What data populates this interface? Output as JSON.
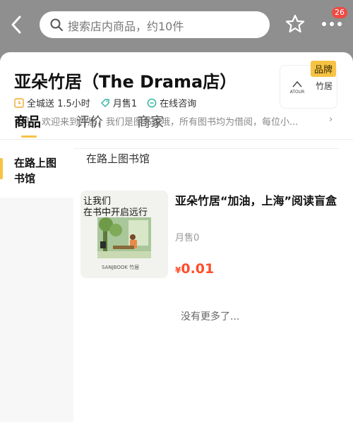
{
  "search": {
    "placeholder": "搜索店内商品，约10件"
  },
  "topbar": {
    "back_icon": "chevron-left-icon",
    "favorite_icon": "star-icon",
    "more_icon": "more-dots-icon",
    "notification_count": "26"
  },
  "store": {
    "name": "亚朵竹居（The Drama店）",
    "delivery": "全城送 1.5小时",
    "monthly_sales": "月售1",
    "consult": "在线咨询",
    "notice": "公告：欢迎来到竹居，我们是图书馆哦，所有图书均为借阅，每位小...",
    "brand_tag": "品牌",
    "logo_text": "竹居",
    "logo_mark": "ATOUR"
  },
  "tabs": [
    {
      "label": "商品",
      "active": true
    },
    {
      "label": "评价",
      "active": false
    },
    {
      "label": "商家",
      "active": false
    }
  ],
  "sidebar": {
    "categories": [
      {
        "label": "在路上图书馆",
        "selected": true
      }
    ]
  },
  "section": {
    "title": "在路上图书馆"
  },
  "product": {
    "thumb_caption_1": "让我们",
    "thumb_caption_2": "在书中开启远行",
    "thumb_brandline": "SANJBOOK 竹居",
    "title": "亚朵竹居“加油，上海”阅读盲盒",
    "sold": "月售0",
    "currency": "¥",
    "price": "0.01"
  },
  "footer": {
    "end_text": "没有更多了..."
  },
  "colors": {
    "accent": "#f6c344",
    "price": "#ff4d2a",
    "badge": "#ef4a43"
  }
}
